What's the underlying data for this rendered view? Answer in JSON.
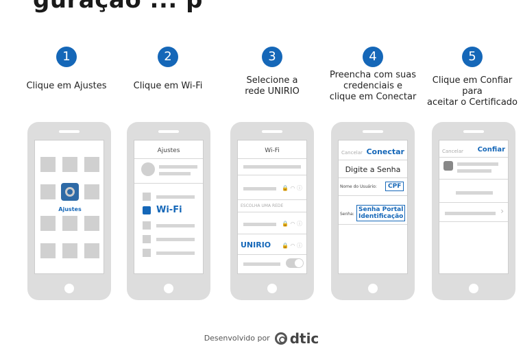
{
  "header_fragment": "guração ... p",
  "steps": [
    {
      "number": "1",
      "caption": "Clique em Ajustes"
    },
    {
      "number": "2",
      "caption": "Clique em Wi-Fi"
    },
    {
      "number": "3",
      "caption": "Selecione a\nrede UNIRIO"
    },
    {
      "number": "4",
      "caption": "Preencha com suas\ncredenciais e\nclique em Conectar"
    },
    {
      "number": "5",
      "caption": "Clique em Confiar para\naceitar o Certificado"
    }
  ],
  "phone1": {
    "app_label": "Ajustes"
  },
  "phone2": {
    "title": "Ajustes",
    "wifi_label": "Wi-Fi"
  },
  "phone3": {
    "title": "Wi-Fi",
    "choose_network": "ESCOLHA UMA REDE",
    "network": "UNIRIO"
  },
  "phone4": {
    "cancel": "Cancelar",
    "connect": "Conectar",
    "prompt": "Digite a Senha",
    "user_label": "Nome do Usuário:",
    "user_value": "CPF",
    "password_label": "Senha:",
    "password_value": "Senha Portal\nIdentificação"
  },
  "phone5": {
    "cancel": "Cancelar",
    "trust": "Confiar"
  },
  "footer": {
    "prefix": "Desenvolvido por",
    "brand": "dtic"
  },
  "colors": {
    "accent": "#1567b8",
    "phone_body": "#dddddd"
  }
}
